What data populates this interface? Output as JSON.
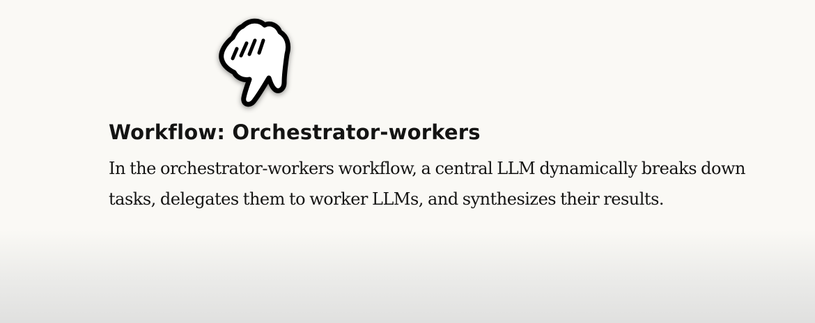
{
  "section": {
    "title": "Workflow: Orchestrator-workers",
    "body": "In the orchestrator-workers workflow, a central LLM dynamically breaks down tasks, delegates them to worker LLMs, and synthesizes their results."
  },
  "cursor": {
    "icon": "pointing-hand-icon",
    "fill": "#ffffff",
    "stroke": "#000000"
  }
}
